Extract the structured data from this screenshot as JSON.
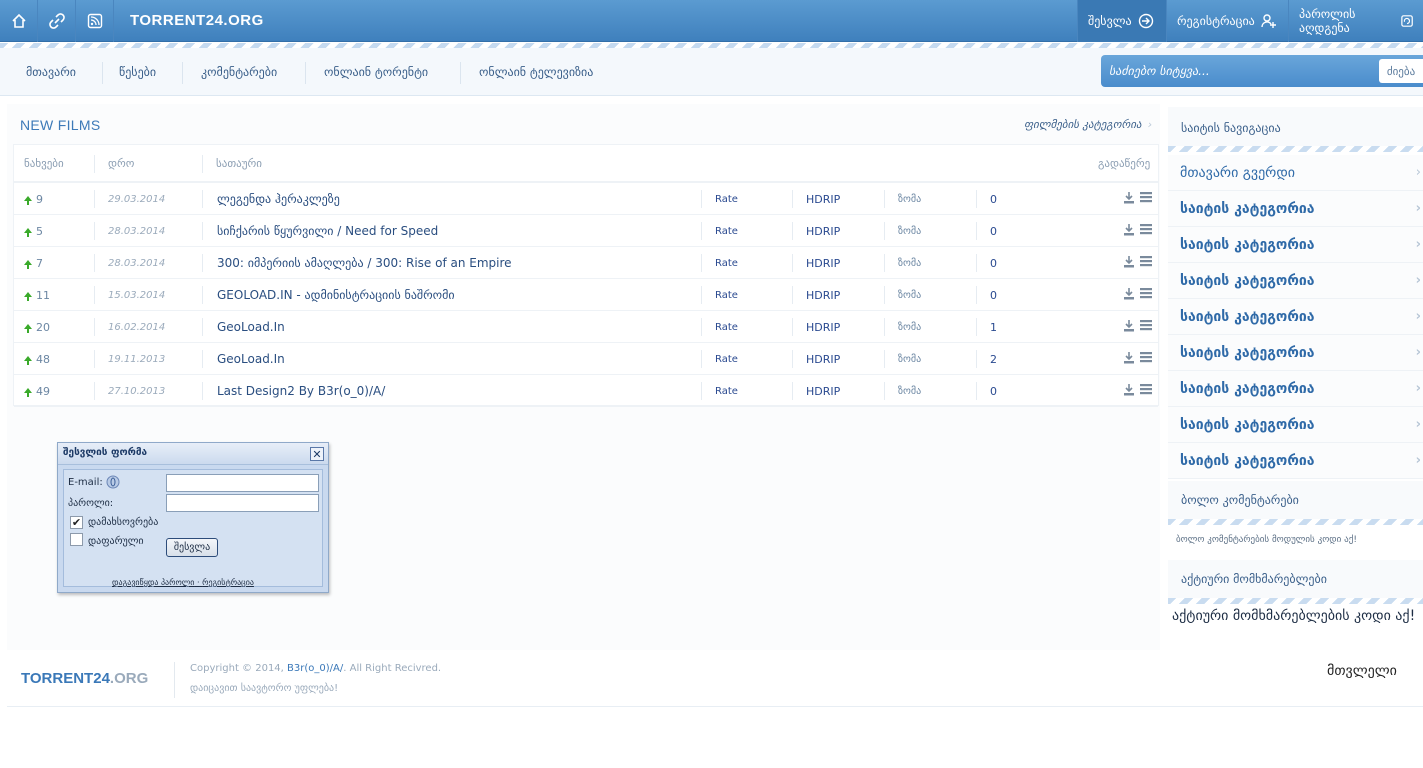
{
  "topbar": {
    "brand": "TORRENT24.ORG",
    "icons": [
      "home-icon",
      "link-icon",
      "rss-icon"
    ],
    "login_label": "შესვლა",
    "register_label": "რეგისტრაცია",
    "recover_label": "პაროლის აღდგენა"
  },
  "nav": {
    "items": [
      "მთავარი",
      "წესები",
      "კომენტარები",
      "ონლაინ ტორენტი",
      "ონლაინ ტელევიზია"
    ]
  },
  "search": {
    "placeholder": "საძიებო სიტყვა...",
    "button_label": "ძიება"
  },
  "main": {
    "title": "NEW FILMS",
    "category_link": "ფილმების კატეგორია",
    "columns": {
      "views": "ნახვები",
      "time": "დრო",
      "title": "სათაური",
      "download": "გადაწერე"
    },
    "rows": [
      {
        "views": "9",
        "date": "29.03.2014",
        "title": "ლეგენდა ჰერაკლეზე",
        "rate": "Rate",
        "quality": "HDRIP",
        "size": "ზომა",
        "count": "0"
      },
      {
        "views": "5",
        "date": "28.03.2014",
        "title": "სიჩქარის წყურვილი / Need for Speed",
        "rate": "Rate",
        "quality": "HDRIP",
        "size": "ზომა",
        "count": "0"
      },
      {
        "views": "7",
        "date": "28.03.2014",
        "title": "300: იმპერიის ამაღლება / 300: Rise of an Empire",
        "rate": "Rate",
        "quality": "HDRIP",
        "size": "ზომა",
        "count": "0"
      },
      {
        "views": "11",
        "date": "15.03.2014",
        "title": "GEOLOAD.IN - ადმინისტრაციის ნაშრომი",
        "rate": "Rate",
        "quality": "HDRIP",
        "size": "ზომა",
        "count": "0"
      },
      {
        "views": "20",
        "date": "16.02.2014",
        "title": "GeoLoad.In",
        "rate": "Rate",
        "quality": "HDRIP",
        "size": "ზომა",
        "count": "1"
      },
      {
        "views": "48",
        "date": "19.11.2013",
        "title": "GeoLoad.In",
        "rate": "Rate",
        "quality": "HDRIP",
        "size": "ზომა",
        "count": "2"
      },
      {
        "views": "49",
        "date": "27.10.2013",
        "title": "Last Design2 By B3r(o_0)/A/",
        "rate": "Rate",
        "quality": "HDRIP",
        "size": "ზომა",
        "count": "0"
      }
    ]
  },
  "login": {
    "title": "შესვლის ფორმა",
    "email_label": "E-mail:",
    "email_value": "",
    "password_label": "პაროლი:",
    "password_value": "",
    "remember_label": "დამახსოვრება",
    "remember_checked": true,
    "hidden_label": "დაფარული",
    "hidden_checked": false,
    "submit_label": "შესვლა",
    "forgot_link": "დაგავიწყდა პაროლი",
    "link_separator": "·",
    "register_link": "რეგისტრაცია"
  },
  "sidebar": {
    "nav_title": "საიტის ნავიგაცია",
    "home_item": "მთავარი გვერდი",
    "categories": [
      "საიტის კატეგორია",
      "საიტის კატეგორია",
      "საიტის კატეგორია",
      "საიტის კატეგორია",
      "საიტის კატეგორია",
      "საიტის კატეგორია",
      "საიტის კატეგორია",
      "საიტის კატეგორია"
    ],
    "comments_title": "ბოლო კომენტარები",
    "comments_text": "ბოლო კომენტარების მოდულის კოდი აქ!",
    "users_title": "აქტიური მომხმარებლები",
    "users_text": "აქტიური მომხმარებლების კოდი აქ!"
  },
  "footer": {
    "brand_main": "TORRENT24",
    "brand_tld": ".ORG",
    "copyright_prefix": "Copyright © 2014,",
    "copyright_author": "B3r(o_0)/A/",
    "copyright_suffix": ". All Right Recivred.",
    "rights": "დაიცავით საავტორო უფლება!",
    "counter": "მთვლელი"
  },
  "colors": {
    "topbar": "#4a8bc6",
    "accent": "#3d7ab8",
    "link": "#2a4e80",
    "up_arrow": "#3aaa2a"
  }
}
